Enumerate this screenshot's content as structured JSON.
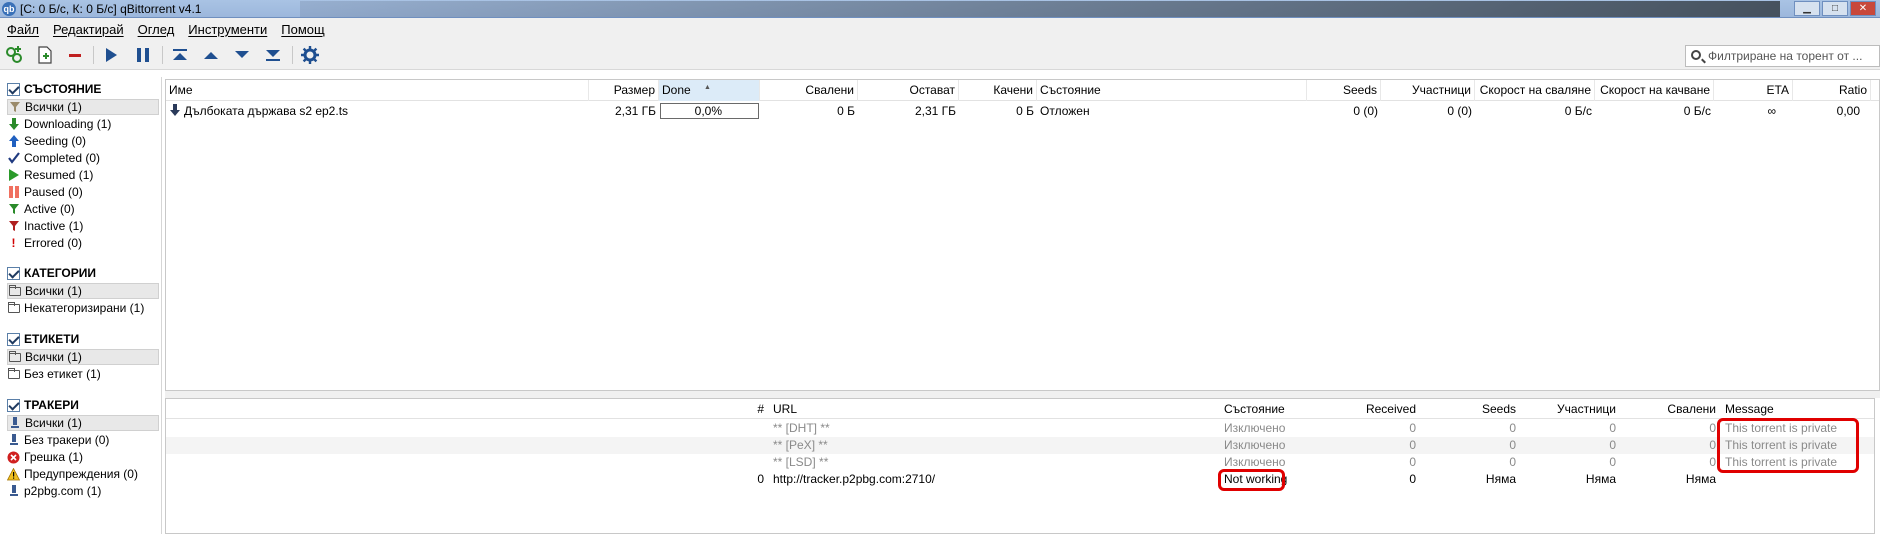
{
  "window": {
    "title": "[С: 0 Б/с, К: 0 Б/с] qBittorrent v4.1"
  },
  "menu": [
    "Файл",
    "Редактирай",
    "Оглед",
    "Инструменти",
    "Помощ"
  ],
  "toolbar": {
    "icons": [
      "add-link-icon",
      "add-file-icon",
      "remove-icon",
      "resume-icon",
      "pause-icon",
      "move-top-icon",
      "move-up-icon",
      "move-down-icon",
      "move-bottom-icon",
      "options-icon"
    ]
  },
  "search": {
    "placeholder": "Филтриране на торент от ..."
  },
  "sidebar": {
    "status": {
      "header": "СЪСТОЯНИЕ",
      "items": [
        {
          "label": "Всички (1)",
          "icon": "filter-icon",
          "color": "#8a7a5a"
        },
        {
          "label": "Downloading (1)",
          "icon": "download-arrow-icon",
          "color": "#2a8a2a"
        },
        {
          "label": "Seeding (0)",
          "icon": "upload-arrow-icon",
          "color": "#2060c0"
        },
        {
          "label": "Completed (0)",
          "icon": "checkmark-icon",
          "color": "#1f3a80"
        },
        {
          "label": "Resumed (1)",
          "icon": "play-icon",
          "color": "#2a9a2a"
        },
        {
          "label": "Paused (0)",
          "icon": "pause-icon",
          "color": "#f07060"
        },
        {
          "label": "Active (0)",
          "icon": "filter-green-icon",
          "color": "#2a8a2a"
        },
        {
          "label": "Inactive (1)",
          "icon": "filter-red-icon",
          "color": "#b02020"
        },
        {
          "label": "Errored (0)",
          "icon": "exclamation-icon",
          "color": "#d00000"
        }
      ]
    },
    "categories": {
      "header": "КАТЕГОРИИ",
      "items": [
        {
          "label": "Всички (1)"
        },
        {
          "label": "Некатегоризирани (1)"
        }
      ]
    },
    "tags": {
      "header": "ЕТИКЕТИ",
      "items": [
        {
          "label": "Всички (1)"
        },
        {
          "label": "Без етикет (1)"
        }
      ]
    },
    "trackers": {
      "header": "ТРАКЕРИ",
      "items": [
        {
          "label": "Всички (1)",
          "icon": "tracker-icon"
        },
        {
          "label": "Без тракери (0)",
          "icon": "tracker-icon"
        },
        {
          "label": "Грешка (1)",
          "icon": "error-icon"
        },
        {
          "label": "Предупреждения (0)",
          "icon": "warning-icon"
        },
        {
          "label": "p2pbg.com (1)",
          "icon": "tracker-icon"
        }
      ]
    }
  },
  "torrents": {
    "columns": [
      "Име",
      "Размер",
      "Done",
      "Свалени",
      "Остават",
      "Качени",
      "Състояние",
      "Seeds",
      "Участници",
      "Скорост на сваляне",
      "Скорост на качване",
      "ETA",
      "Ratio"
    ],
    "rows": [
      {
        "name": "Дълбоката държава s2 ep2.ts",
        "size": "2,31 ГБ",
        "done": "0,0%",
        "progress": 0.0,
        "downloaded": "0 Б",
        "remaining": "2,31 ГБ",
        "uploaded": "0 Б",
        "status": "Отложен",
        "seeds": "0 (0)",
        "peers": "0 (0)",
        "dl_speed": "0 Б/с",
        "ul_speed": "0 Б/с",
        "eta": "∞",
        "ratio": "0,00"
      }
    ]
  },
  "trackers_table": {
    "columns": [
      "#",
      "URL",
      "Състояние",
      "Received",
      "Seeds",
      "Участници",
      "Свалени",
      "Message"
    ],
    "rows": [
      {
        "num": "",
        "url": "** [DHT] **",
        "status": "Изключено",
        "received": "0",
        "seeds": "0",
        "peers": "0",
        "downloaded": "0",
        "message": "This torrent is private"
      },
      {
        "num": "",
        "url": "** [PeX] **",
        "status": "Изключено",
        "received": "0",
        "seeds": "0",
        "peers": "0",
        "downloaded": "0",
        "message": "This torrent is private"
      },
      {
        "num": "",
        "url": "** [LSD] **",
        "status": "Изключено",
        "received": "0",
        "seeds": "0",
        "peers": "0",
        "downloaded": "0",
        "message": "This torrent is private"
      },
      {
        "num": "0",
        "url": "http://tracker.p2pbg.com:2710/",
        "status": "Not working",
        "received": "0",
        "seeds": "Няма",
        "peers": "Няма",
        "downloaded": "Няма",
        "message": ""
      }
    ]
  },
  "colors": {
    "highlight": "#e00000",
    "progress": "#3c8ad0"
  }
}
